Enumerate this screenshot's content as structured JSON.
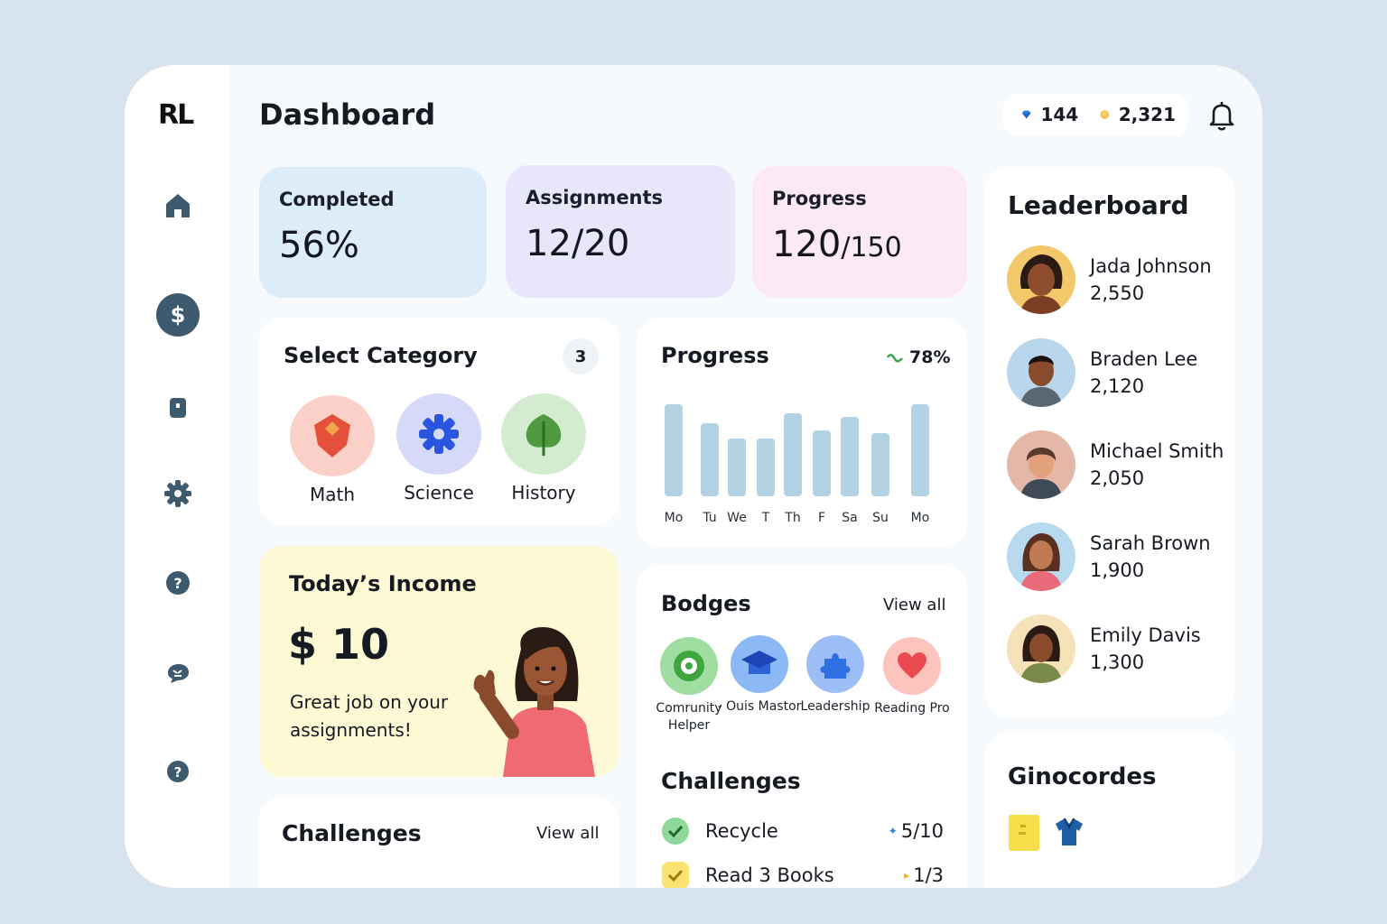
{
  "app": {
    "logo": "RL",
    "title": "Dashboard"
  },
  "sidebar": {
    "items": [
      {
        "icon": "home-icon"
      },
      {
        "icon": "dollar-icon"
      },
      {
        "icon": "bookmark-icon"
      },
      {
        "icon": "gear-icon"
      },
      {
        "icon": "help-icon"
      },
      {
        "icon": "chat-icon"
      },
      {
        "icon": "help-icon"
      }
    ]
  },
  "header": {
    "gems": "144",
    "coins": "2,321"
  },
  "stats": {
    "completed": {
      "label": "Completed",
      "value": "56%",
      "color": "#dcecf9"
    },
    "assignments": {
      "label": "Assignments",
      "value": "12/20",
      "color": "#e7e6fb"
    },
    "progress": {
      "label": "Progress",
      "value_main": "120",
      "value_total": "/150",
      "color": "#fbe9f6"
    }
  },
  "categories": {
    "title": "Select Category",
    "count": "3",
    "items": [
      {
        "name": "Math",
        "icon": "shield-icon",
        "color": "#fbd0c8"
      },
      {
        "name": "Science",
        "icon": "gear-icon",
        "color": "#d6daf8"
      },
      {
        "name": "History",
        "icon": "leaf-icon",
        "color": "#d3ecd0"
      }
    ]
  },
  "weekly_progress": {
    "title": "Progress",
    "percent": "78%"
  },
  "chart_data": {
    "type": "bar",
    "categories": [
      "Mo",
      "Tu",
      "We",
      "T",
      "Th",
      "F",
      "Sa",
      "Su",
      "Mo"
    ],
    "values": [
      100,
      79,
      63,
      63,
      90,
      72,
      86,
      69,
      100
    ],
    "ylim": [
      0,
      100
    ],
    "grid": false,
    "color": "#b3d2e4"
  },
  "income": {
    "title": "Today’s Income",
    "currency": "$",
    "amount": "10",
    "message": "Great job on your assignments!",
    "color": "#fdf9d4"
  },
  "challenges_left": {
    "title": "Challenges",
    "view_all": "View all"
  },
  "badges": {
    "title": "Bodges",
    "view_all": "View all",
    "items": [
      {
        "name": "Comrunity Helper",
        "icon": "gear-badge-icon",
        "color": "#8ed58e"
      },
      {
        "name": "- Ouis Mastor",
        "icon": "graduation-cap-icon",
        "color": "#7aaef2"
      },
      {
        "name": "Leadership",
        "icon": "puzzle-icon",
        "color": "#8db3f5"
      },
      {
        "name": "Reading Pro",
        "icon": "heart-icon",
        "color": "#fbb7b0"
      }
    ]
  },
  "challenges": {
    "title": "Challenges",
    "items": [
      {
        "name": "Recycle",
        "progress": "5/10",
        "status": "done",
        "color": "#8fd89b"
      },
      {
        "name": "Read 3 Books",
        "progress": "1/3",
        "status": "in-progress",
        "color": "#fbe272"
      }
    ]
  },
  "leaderboard": {
    "title": "Leaderboard",
    "players": [
      {
        "name": "Jada Johnson",
        "score": "2,550",
        "bg": "#f2c86a"
      },
      {
        "name": "Braden Lee",
        "score": "2,120",
        "bg": "#b9d6ec"
      },
      {
        "name": "Michael Smith",
        "score": "2,050",
        "bg": "#e4b8a8"
      },
      {
        "name": "Sarah Brown",
        "score": "1,900",
        "bg": "#b7daef"
      },
      {
        "name": "Emily Davis",
        "score": "1,300",
        "bg": "#f6e2b9"
      }
    ]
  },
  "ginocordes": {
    "title": "Ginocordes"
  }
}
